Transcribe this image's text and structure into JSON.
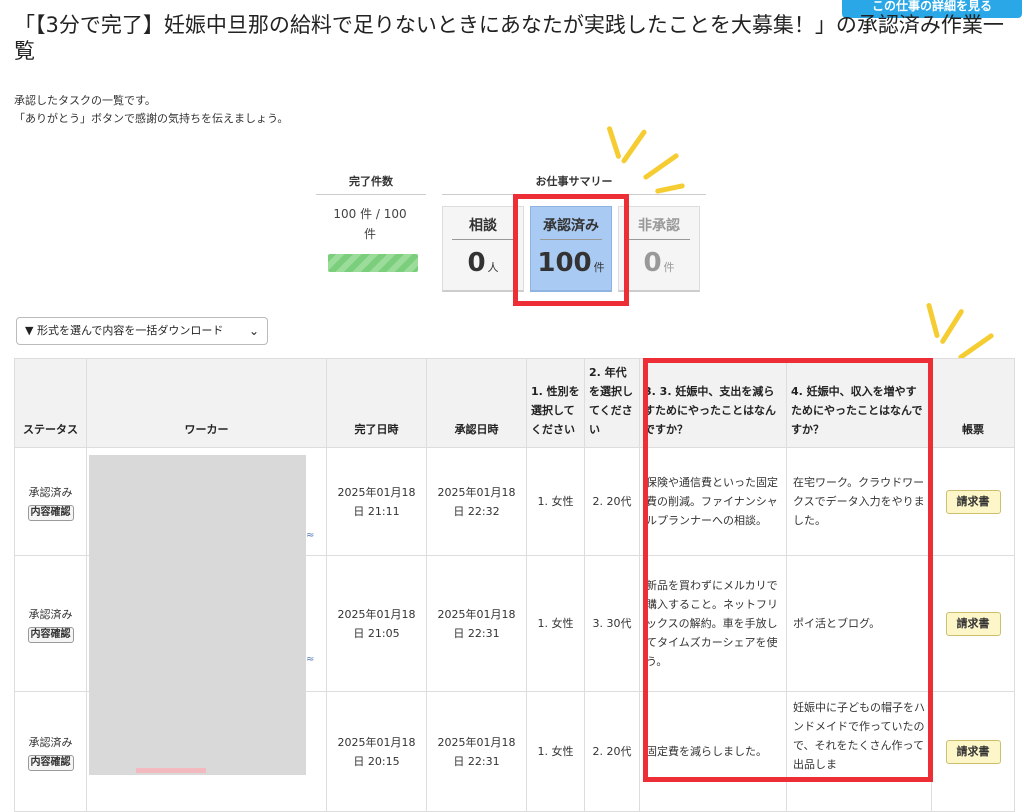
{
  "page": {
    "title": "「【3分で完了】妊娠中旦那の給料で足りないときにあなたが実践したことを大募集！」の承認済み作業一覧",
    "detail_button": "この仕事の詳細を見る",
    "intro": [
      "承認したタスクの一覧です。",
      "「ありがとう」ボタンで感謝の気持ちを伝えましょう。"
    ]
  },
  "summary": {
    "completed_header": "完了件数",
    "completed_text": "100 件 / 100 件",
    "progress": 1.0,
    "work_header": "お仕事サマリー",
    "cards": [
      {
        "label": "相談",
        "value": "0",
        "unit": "人"
      },
      {
        "label": "承認済み",
        "value": "100",
        "unit": "件"
      },
      {
        "label": "非承認",
        "value": "0",
        "unit": "件"
      }
    ]
  },
  "download": {
    "label": "▼ 形式を選んで内容を一括ダウンロード",
    "chevron": "⌄"
  },
  "table": {
    "headers": {
      "status": "ステータス",
      "worker": "ワーカー",
      "completed": "完了日時",
      "approved": "承認日時",
      "q1": "1. 性別を選択してください",
      "q2": "2. 年代を選択してください",
      "q3": "3. 3. 妊娠中、支出を減らすためにやったことはなんですか？",
      "q4": "4. 妊娠中、収入を増やすためにやったことはなんですか？",
      "invoice": "帳票"
    },
    "rows": [
      {
        "status": "承認済み",
        "check": "内容確認",
        "completed": "2025年01月18日 21:11",
        "approved": "2025年01月18日 22:32",
        "gender": "1. 女性",
        "age": "2. 20代",
        "q3": "保険や通信費といった固定費の削減。ファイナンシャルプランナーへの相談。",
        "q4": "在宅ワーク。クラウドワークスでデータ入力をやりました。",
        "invoice": "請求書"
      },
      {
        "status": "承認済み",
        "check": "内容確認",
        "completed": "2025年01月18日 21:05",
        "approved": "2025年01月18日 22:31",
        "gender": "1. 女性",
        "age": "3. 30代",
        "q3": "新品を買わずにメルカリで購入すること。ネットフリックスの解約。車を手放してタイムズカーシェアを使う。",
        "q4": "ポイ活とブログ。",
        "invoice": "請求書"
      },
      {
        "status": "承認済み",
        "check": "内容確認",
        "completed": "2025年01月18日 20:15",
        "approved": "2025年01月18日 22:31",
        "gender": "1. 女性",
        "age": "2. 20代",
        "q3": "固定費を減らしました。",
        "q4": "妊娠中に子どもの帽子をハンドメイドで作っていたので、それをたくさん作って出品しま",
        "invoice": "請求書"
      }
    ]
  },
  "colors": {
    "highlight": "#ee2e36",
    "accent_yellow": "#f5cd33",
    "active_card": "#a9caf2",
    "button_blue": "#2aa7e6"
  }
}
